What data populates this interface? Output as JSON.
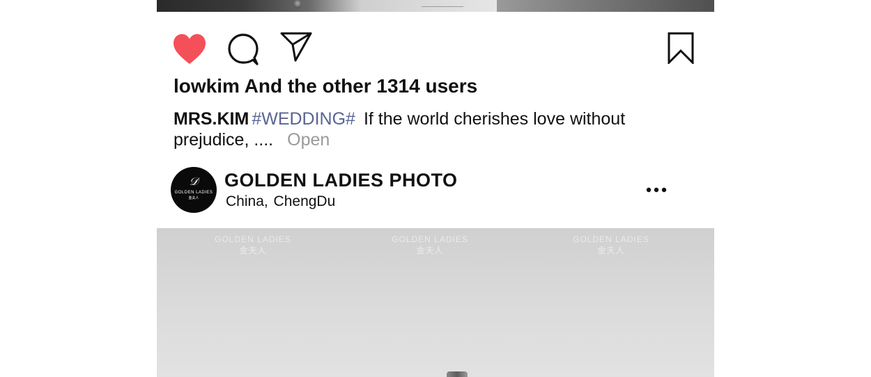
{
  "post": {
    "likes_text": "lowkim And the other 1314 users",
    "caption": {
      "author": "MRS.KIM",
      "hashtag": "#WEDDING#",
      "text": "If the world cherishes love without prejudice, ....",
      "more": "Open"
    },
    "actions": {
      "like_icon": "heart-filled-icon",
      "comment_icon": "speech-bubble-icon",
      "share_icon": "paper-plane-icon",
      "bookmark_icon": "bookmark-icon",
      "liked": true,
      "like_color": "#f4505a"
    }
  },
  "next_post": {
    "account_name": "GOLDEN LADIES PHOTO",
    "location_country": "China,",
    "location_city": "ChengDu",
    "avatar": {
      "monogram": "𝒟",
      "brand": "GOLDEN LADIES",
      "sub": "金夫人"
    },
    "more_icon": "ellipsis-icon",
    "watermark": {
      "line1": "GOLDEN LADIES",
      "line2": "金夫人"
    }
  },
  "colors": {
    "hashtag": "#5a6494",
    "muted": "#9a9a9a",
    "text": "#111111"
  }
}
